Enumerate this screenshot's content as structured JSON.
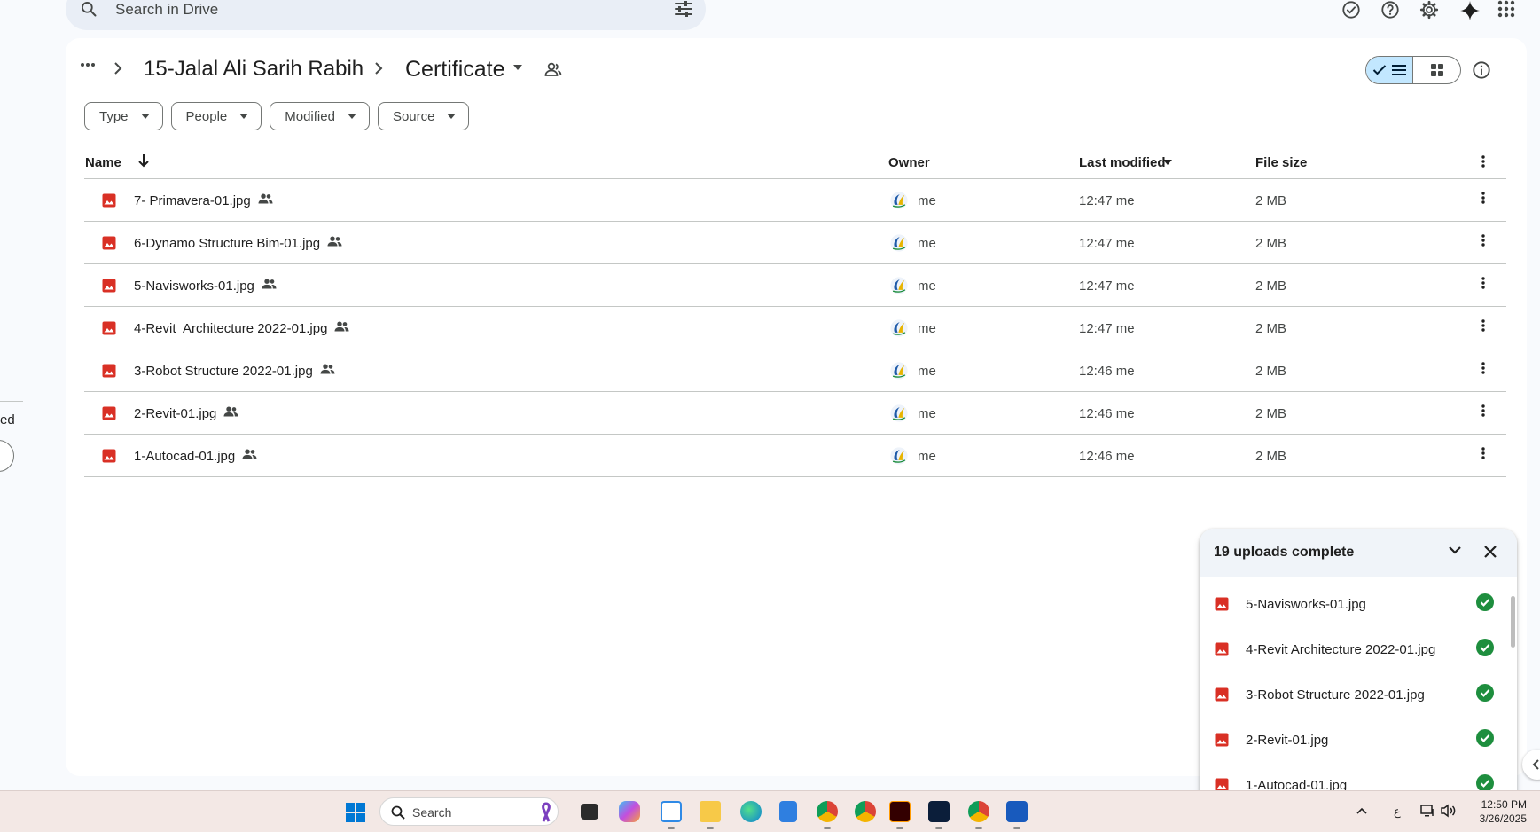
{
  "search": {
    "placeholder": "Search in Drive"
  },
  "left_edge": {
    "fragment_text": "ed"
  },
  "breadcrumb": {
    "parent": "15-Jalal Ali Sarih Rabih",
    "current": "Certificate"
  },
  "filters": [
    {
      "label": "Type"
    },
    {
      "label": "People"
    },
    {
      "label": "Modified"
    },
    {
      "label": "Source"
    }
  ],
  "columns": {
    "name": "Name",
    "owner": "Owner",
    "last_modified": "Last modified",
    "file_size": "File size"
  },
  "files": [
    {
      "name": "7- Primavera-01.jpg",
      "owner": "me",
      "modified": "12:47",
      "modified_by": "me",
      "size": "2 MB"
    },
    {
      "name": "6-Dynamo Structure Bim-01.jpg",
      "owner": "me",
      "modified": "12:47",
      "modified_by": "me",
      "size": "2 MB"
    },
    {
      "name": "5-Navisworks-01.jpg",
      "owner": "me",
      "modified": "12:47",
      "modified_by": "me",
      "size": "2 MB"
    },
    {
      "name": "4-Revit  Architecture 2022-01.jpg",
      "owner": "me",
      "modified": "12:47",
      "modified_by": "me",
      "size": "2 MB"
    },
    {
      "name": "3-Robot Structure 2022-01.jpg",
      "owner": "me",
      "modified": "12:46",
      "modified_by": "me",
      "size": "2 MB"
    },
    {
      "name": "2-Revit-01.jpg",
      "owner": "me",
      "modified": "12:46",
      "modified_by": "me",
      "size": "2 MB"
    },
    {
      "name": "1-Autocad-01.jpg",
      "owner": "me",
      "modified": "12:46",
      "modified_by": "me",
      "size": "2 MB"
    }
  ],
  "uploads": {
    "title": "19 uploads complete",
    "items": [
      {
        "name": "5-Navisworks-01.jpg"
      },
      {
        "name": "4-Revit Architecture 2022-01.jpg"
      },
      {
        "name": "3-Robot Structure 2022-01.jpg"
      },
      {
        "name": "2-Revit-01.jpg"
      },
      {
        "name": "1-Autocad-01.jpg"
      }
    ]
  },
  "taskbar": {
    "search_label": "Search",
    "language": "ع",
    "time": "12:50 PM",
    "date": "3/26/2025"
  },
  "colors": {
    "accent": "#0b57d0",
    "toggle_active": "#c2e7ff",
    "image_file": "#d93025",
    "upload_success": "#1e8e3e"
  }
}
